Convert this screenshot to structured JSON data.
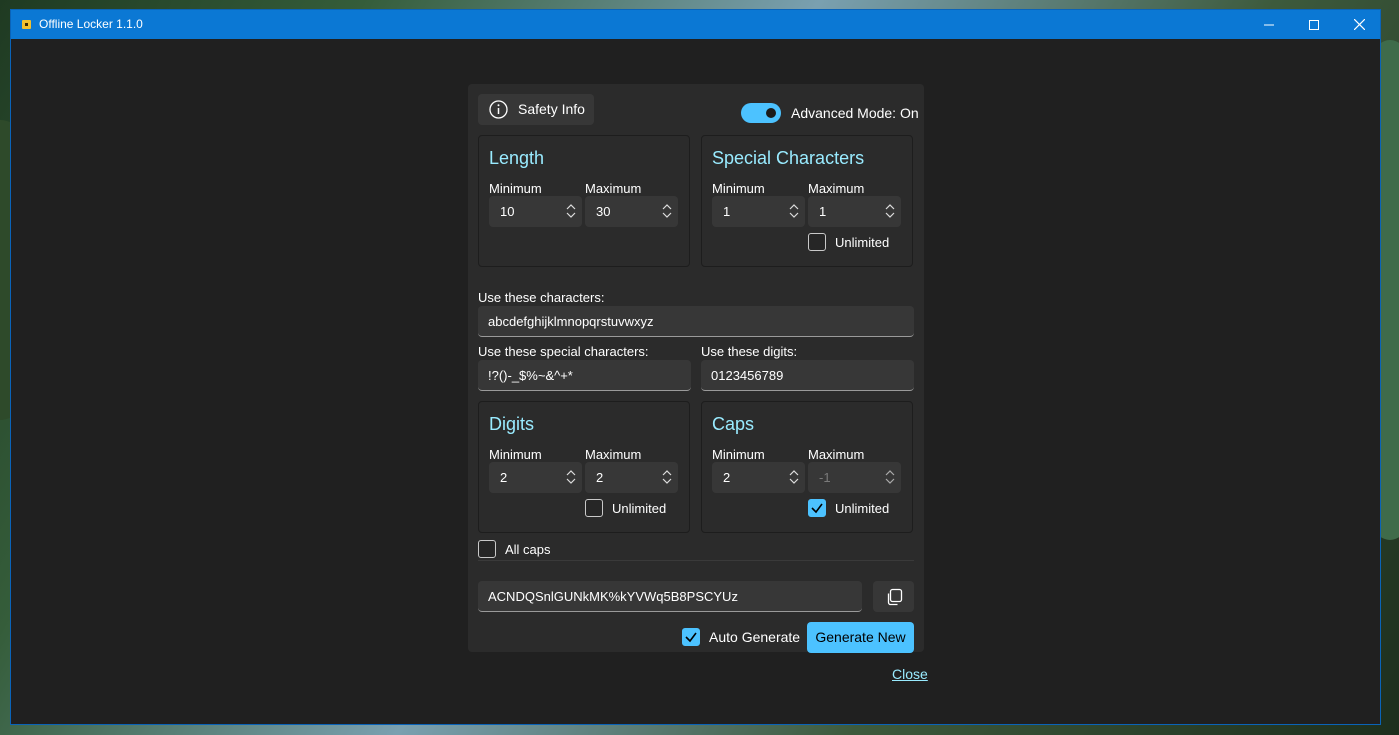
{
  "window": {
    "title": "Offline Locker 1.1.0",
    "accent": "#0b78d4"
  },
  "header": {
    "safety_label": "Safety Info",
    "advanced_label": "Advanced Mode: On",
    "advanced_on": true
  },
  "length": {
    "title": "Length",
    "min_label": "Minimum",
    "max_label": "Maximum",
    "min": "10",
    "max": "30"
  },
  "special": {
    "title": "Special Characters",
    "min_label": "Minimum",
    "max_label": "Maximum",
    "min": "1",
    "max": "1",
    "unlimited_label": "Unlimited",
    "unlimited": false
  },
  "chars": {
    "label": "Use these characters:",
    "value": "abcdefghijklmnopqrstuvwxyz"
  },
  "special_chars": {
    "label": "Use these special characters:",
    "value": "!?()-_$%~&^+*"
  },
  "digit_chars": {
    "label": "Use these digits:",
    "value": "0123456789"
  },
  "digits": {
    "title": "Digits",
    "min_label": "Minimum",
    "max_label": "Maximum",
    "min": "2",
    "max": "2",
    "unlimited_label": "Unlimited",
    "unlimited": false
  },
  "caps": {
    "title": "Caps",
    "min_label": "Minimum",
    "max_label": "Maximum",
    "min": "2",
    "max": "-1",
    "unlimited_label": "Unlimited",
    "unlimited": true
  },
  "all_caps": {
    "label": "All caps",
    "checked": false
  },
  "output": {
    "password": "ACNDQSnlGUNkMK%kYVWq5B8PSCYUz"
  },
  "footer": {
    "auto_label": "Auto Generate",
    "auto_checked": true,
    "generate_label": "Generate New",
    "close_label": "Close"
  },
  "colors": {
    "accent": "#4cc2ff",
    "card_title": "#99ebff",
    "panel": "#2b2b2b",
    "window_bg": "#202020"
  }
}
